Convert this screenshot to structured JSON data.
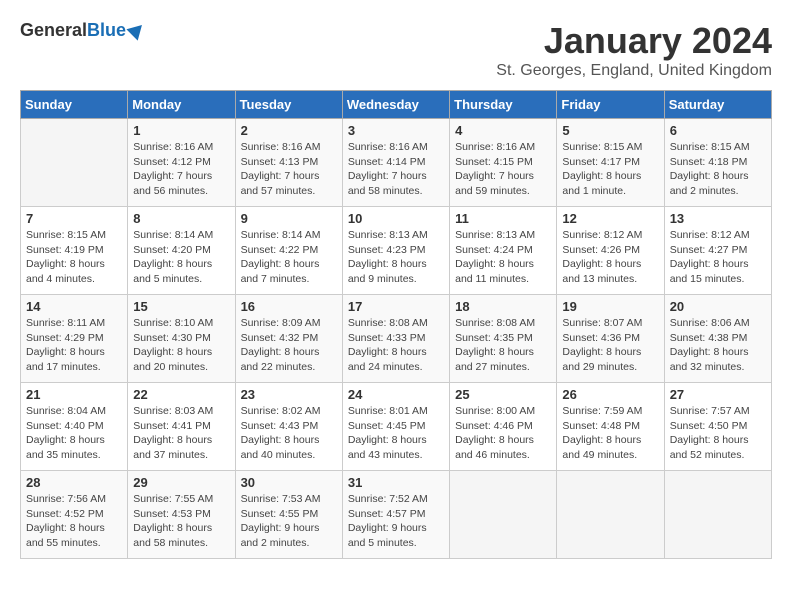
{
  "header": {
    "logo_general": "General",
    "logo_blue": "Blue",
    "month": "January 2024",
    "location": "St. Georges, England, United Kingdom"
  },
  "days_of_week": [
    "Sunday",
    "Monday",
    "Tuesday",
    "Wednesday",
    "Thursday",
    "Friday",
    "Saturday"
  ],
  "weeks": [
    [
      {
        "day": "",
        "info": ""
      },
      {
        "day": "1",
        "info": "Sunrise: 8:16 AM\nSunset: 4:12 PM\nDaylight: 7 hours\nand 56 minutes."
      },
      {
        "day": "2",
        "info": "Sunrise: 8:16 AM\nSunset: 4:13 PM\nDaylight: 7 hours\nand 57 minutes."
      },
      {
        "day": "3",
        "info": "Sunrise: 8:16 AM\nSunset: 4:14 PM\nDaylight: 7 hours\nand 58 minutes."
      },
      {
        "day": "4",
        "info": "Sunrise: 8:16 AM\nSunset: 4:15 PM\nDaylight: 7 hours\nand 59 minutes."
      },
      {
        "day": "5",
        "info": "Sunrise: 8:15 AM\nSunset: 4:17 PM\nDaylight: 8 hours\nand 1 minute."
      },
      {
        "day": "6",
        "info": "Sunrise: 8:15 AM\nSunset: 4:18 PM\nDaylight: 8 hours\nand 2 minutes."
      }
    ],
    [
      {
        "day": "7",
        "info": "Sunrise: 8:15 AM\nSunset: 4:19 PM\nDaylight: 8 hours\nand 4 minutes."
      },
      {
        "day": "8",
        "info": "Sunrise: 8:14 AM\nSunset: 4:20 PM\nDaylight: 8 hours\nand 5 minutes."
      },
      {
        "day": "9",
        "info": "Sunrise: 8:14 AM\nSunset: 4:22 PM\nDaylight: 8 hours\nand 7 minutes."
      },
      {
        "day": "10",
        "info": "Sunrise: 8:13 AM\nSunset: 4:23 PM\nDaylight: 8 hours\nand 9 minutes."
      },
      {
        "day": "11",
        "info": "Sunrise: 8:13 AM\nSunset: 4:24 PM\nDaylight: 8 hours\nand 11 minutes."
      },
      {
        "day": "12",
        "info": "Sunrise: 8:12 AM\nSunset: 4:26 PM\nDaylight: 8 hours\nand 13 minutes."
      },
      {
        "day": "13",
        "info": "Sunrise: 8:12 AM\nSunset: 4:27 PM\nDaylight: 8 hours\nand 15 minutes."
      }
    ],
    [
      {
        "day": "14",
        "info": "Sunrise: 8:11 AM\nSunset: 4:29 PM\nDaylight: 8 hours\nand 17 minutes."
      },
      {
        "day": "15",
        "info": "Sunrise: 8:10 AM\nSunset: 4:30 PM\nDaylight: 8 hours\nand 20 minutes."
      },
      {
        "day": "16",
        "info": "Sunrise: 8:09 AM\nSunset: 4:32 PM\nDaylight: 8 hours\nand 22 minutes."
      },
      {
        "day": "17",
        "info": "Sunrise: 8:08 AM\nSunset: 4:33 PM\nDaylight: 8 hours\nand 24 minutes."
      },
      {
        "day": "18",
        "info": "Sunrise: 8:08 AM\nSunset: 4:35 PM\nDaylight: 8 hours\nand 27 minutes."
      },
      {
        "day": "19",
        "info": "Sunrise: 8:07 AM\nSunset: 4:36 PM\nDaylight: 8 hours\nand 29 minutes."
      },
      {
        "day": "20",
        "info": "Sunrise: 8:06 AM\nSunset: 4:38 PM\nDaylight: 8 hours\nand 32 minutes."
      }
    ],
    [
      {
        "day": "21",
        "info": "Sunrise: 8:04 AM\nSunset: 4:40 PM\nDaylight: 8 hours\nand 35 minutes."
      },
      {
        "day": "22",
        "info": "Sunrise: 8:03 AM\nSunset: 4:41 PM\nDaylight: 8 hours\nand 37 minutes."
      },
      {
        "day": "23",
        "info": "Sunrise: 8:02 AM\nSunset: 4:43 PM\nDaylight: 8 hours\nand 40 minutes."
      },
      {
        "day": "24",
        "info": "Sunrise: 8:01 AM\nSunset: 4:45 PM\nDaylight: 8 hours\nand 43 minutes."
      },
      {
        "day": "25",
        "info": "Sunrise: 8:00 AM\nSunset: 4:46 PM\nDaylight: 8 hours\nand 46 minutes."
      },
      {
        "day": "26",
        "info": "Sunrise: 7:59 AM\nSunset: 4:48 PM\nDaylight: 8 hours\nand 49 minutes."
      },
      {
        "day": "27",
        "info": "Sunrise: 7:57 AM\nSunset: 4:50 PM\nDaylight: 8 hours\nand 52 minutes."
      }
    ],
    [
      {
        "day": "28",
        "info": "Sunrise: 7:56 AM\nSunset: 4:52 PM\nDaylight: 8 hours\nand 55 minutes."
      },
      {
        "day": "29",
        "info": "Sunrise: 7:55 AM\nSunset: 4:53 PM\nDaylight: 8 hours\nand 58 minutes."
      },
      {
        "day": "30",
        "info": "Sunrise: 7:53 AM\nSunset: 4:55 PM\nDaylight: 9 hours\nand 2 minutes."
      },
      {
        "day": "31",
        "info": "Sunrise: 7:52 AM\nSunset: 4:57 PM\nDaylight: 9 hours\nand 5 minutes."
      },
      {
        "day": "",
        "info": ""
      },
      {
        "day": "",
        "info": ""
      },
      {
        "day": "",
        "info": ""
      }
    ]
  ]
}
